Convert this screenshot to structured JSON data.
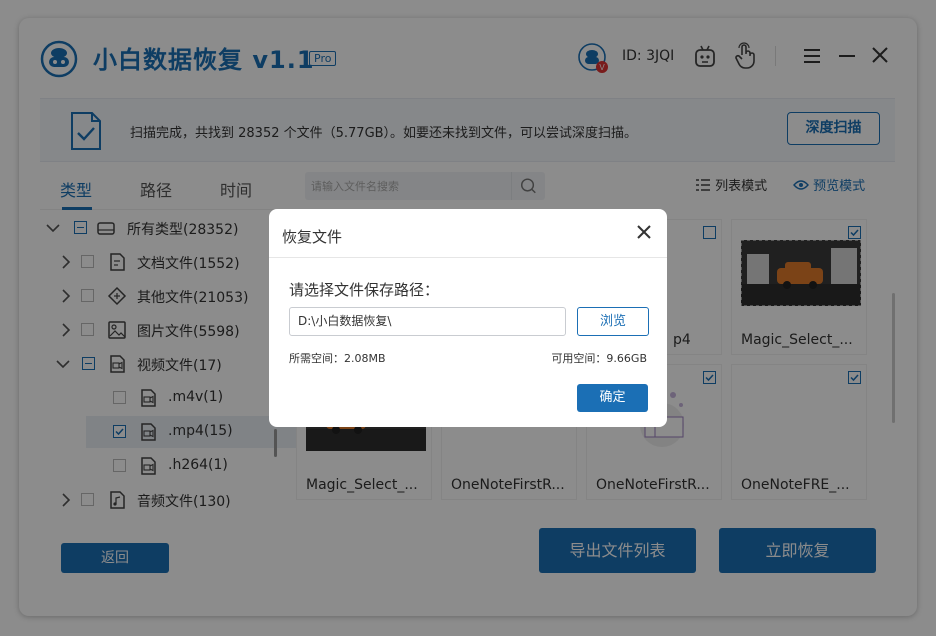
{
  "app": {
    "title": "小白数据恢复",
    "version": "v1.1",
    "badge": "Pro",
    "user_id": "ID: 3JQI"
  },
  "icons": {
    "logo": "robot-logo-icon",
    "avatar": "user-avatar-icon",
    "robot": "robot-assistant-icon",
    "hand": "touch-hand-icon",
    "menu": "menu-icon",
    "minimize": "minimize-icon",
    "close": "close-icon"
  },
  "status": {
    "text": "扫描完成，共找到 28352 个文件（5.77GB）。如要还未找到文件，可以尝试深度扫描。",
    "deep_scan": "深度扫描"
  },
  "tabs": [
    {
      "label": "类型",
      "active": true
    },
    {
      "label": "路径",
      "active": false
    },
    {
      "label": "时间",
      "active": false
    }
  ],
  "tree": [
    {
      "label": "所有类型(28352)",
      "icon": "drive-icon",
      "state": "partial",
      "level": 0,
      "expanded": true
    },
    {
      "label": "文档文件(1552)",
      "icon": "document-icon",
      "state": "unchecked",
      "level": 1
    },
    {
      "label": "其他文件(21053)",
      "icon": "other-file-icon",
      "state": "unchecked",
      "level": 1
    },
    {
      "label": "图片文件(5598)",
      "icon": "image-file-icon",
      "state": "unchecked",
      "level": 1
    },
    {
      "label": "视频文件(17)",
      "icon": "video-file-icon",
      "state": "partial",
      "level": 1,
      "expanded": true
    },
    {
      "label": ".m4v(1)",
      "icon": "video-file-icon",
      "state": "unchecked",
      "level": 2
    },
    {
      "label": ".mp4(15)",
      "icon": "video-file-icon",
      "state": "checked",
      "level": 2,
      "selected": true
    },
    {
      "label": ".h264(1)",
      "icon": "video-file-icon",
      "state": "unchecked",
      "level": 2
    },
    {
      "label": "音频文件(130)",
      "icon": "audio-file-icon",
      "state": "unchecked",
      "level": 1
    }
  ],
  "search": {
    "placeholder": "请输入文件名搜索"
  },
  "view": {
    "list_mode": "列表模式",
    "preview_mode": "预览模式"
  },
  "files": {
    "row1_partial": "p4",
    "row1": [
      "Magic_Select_..."
    ],
    "row2": [
      "Magic_Select_...",
      "OneNoteFirstR...",
      "OneNoteFirstR...",
      "OneNoteFRE_..."
    ]
  },
  "buttons": {
    "back": "返回",
    "export": "导出文件列表",
    "recover": "立即恢复"
  },
  "dialog": {
    "title": "恢复文件",
    "prompt": "请选择文件保存路径：",
    "path": "D:\\小白数据恢复\\",
    "browse": "浏览",
    "space_needed": "所需空间：2.08MB",
    "space_free": "可用空间：9.66GB",
    "confirm": "确定"
  },
  "colors": {
    "accent": "#1b6fb5",
    "overlay": "rgba(0,0,0,0.45)"
  }
}
